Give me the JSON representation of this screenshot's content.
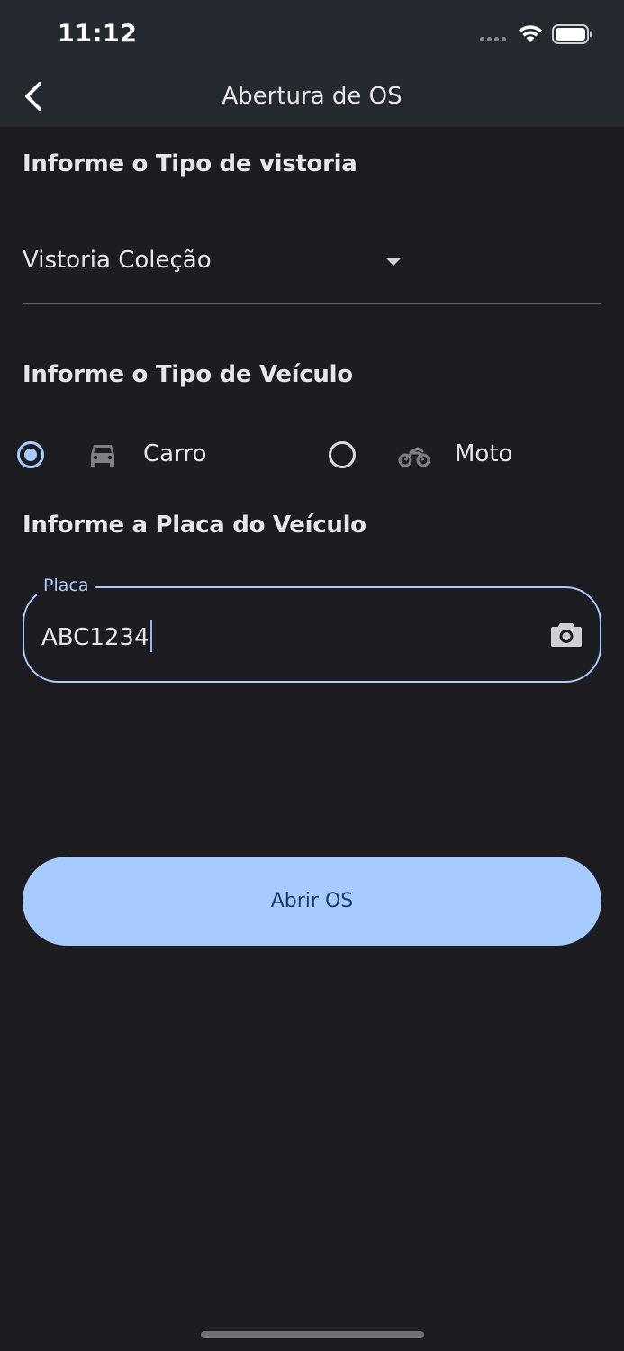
{
  "status_bar": {
    "time": "11:12"
  },
  "app_bar": {
    "title": "Abertura de OS",
    "back_icon": "chevron-left-icon"
  },
  "inspection_type": {
    "heading": "Informe o Tipo de vistoria",
    "selected_value": "Vistoria Coleção"
  },
  "vehicle_type": {
    "heading": "Informe o Tipo de Veículo",
    "options": [
      {
        "label": "Carro",
        "icon": "car-icon",
        "selected": true
      },
      {
        "label": "Moto",
        "icon": "motorcycle-icon",
        "selected": false
      }
    ]
  },
  "plate": {
    "heading": "Informe a Placa do Veículo",
    "field_label": "Placa",
    "value": "ABC1234",
    "icon": "camera-icon"
  },
  "submit": {
    "label": "Abrir OS"
  },
  "colors": {
    "background": "#1d1d21",
    "app_bar": "#252a31",
    "accent": "#a9cbff",
    "button_text": "#1b3a66"
  }
}
